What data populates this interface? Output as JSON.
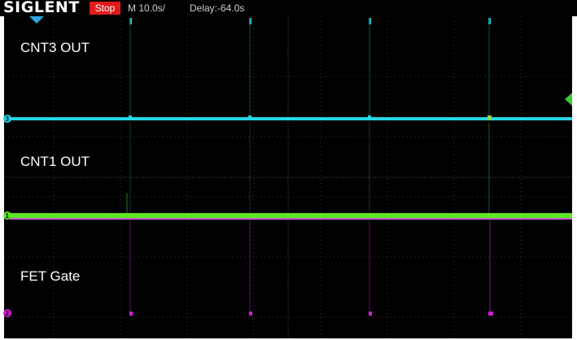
{
  "toolbar": {
    "brand": "SIGLENT",
    "run_state": "Stop",
    "timebase": "M 10.0s/",
    "delay": "Delay:-64.0s"
  },
  "channels": [
    {
      "id": "3",
      "label": "CNT3 OUT",
      "color": "#23d7e8"
    },
    {
      "id": "1",
      "label": "CNT1 OUT",
      "color": "#5ce825"
    },
    {
      "id": "2",
      "label": "FET Gate",
      "color": "#d11ad8"
    }
  ],
  "colors": {
    "stop_bg": "#e11b1b",
    "grid": "#3a3a3a",
    "trigger_marker": "#2fa5e0",
    "trigger_level": "#33cc33"
  }
}
